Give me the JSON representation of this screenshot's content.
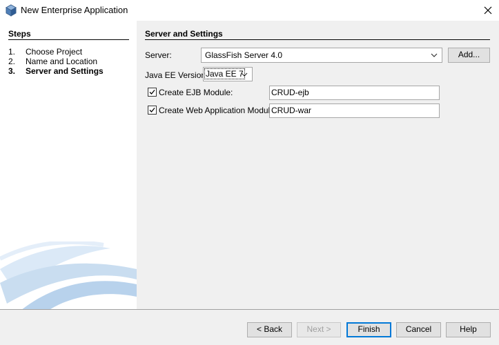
{
  "window": {
    "title": "New Enterprise Application",
    "icon": "cube-icon",
    "close_icon": "close-icon"
  },
  "steps": {
    "title": "Steps",
    "items": [
      {
        "num": "1.",
        "label": "Choose Project"
      },
      {
        "num": "2.",
        "label": "Name and Location"
      },
      {
        "num": "3.",
        "label": "Server and Settings"
      }
    ]
  },
  "panel": {
    "title": "Server and Settings",
    "server_label": "Server:",
    "server_value": "GlassFish Server 4.0",
    "add_button": "Add...",
    "javaee_label": "Java EE Version:",
    "javaee_value": "Java EE 7",
    "ejb": {
      "label": "Create EJB Module:",
      "checked": true,
      "value": "CRUD-ejb"
    },
    "web": {
      "label": "Create Web Application Module:",
      "checked": true,
      "value": "CRUD-war"
    }
  },
  "buttons": {
    "back": "< Back",
    "next": "Next >",
    "finish": "Finish",
    "cancel": "Cancel",
    "help": "Help"
  },
  "colors": {
    "focus": "#0078d7",
    "panel_bg": "#f0f0f0",
    "decor_blue": "#c9ddf0"
  }
}
